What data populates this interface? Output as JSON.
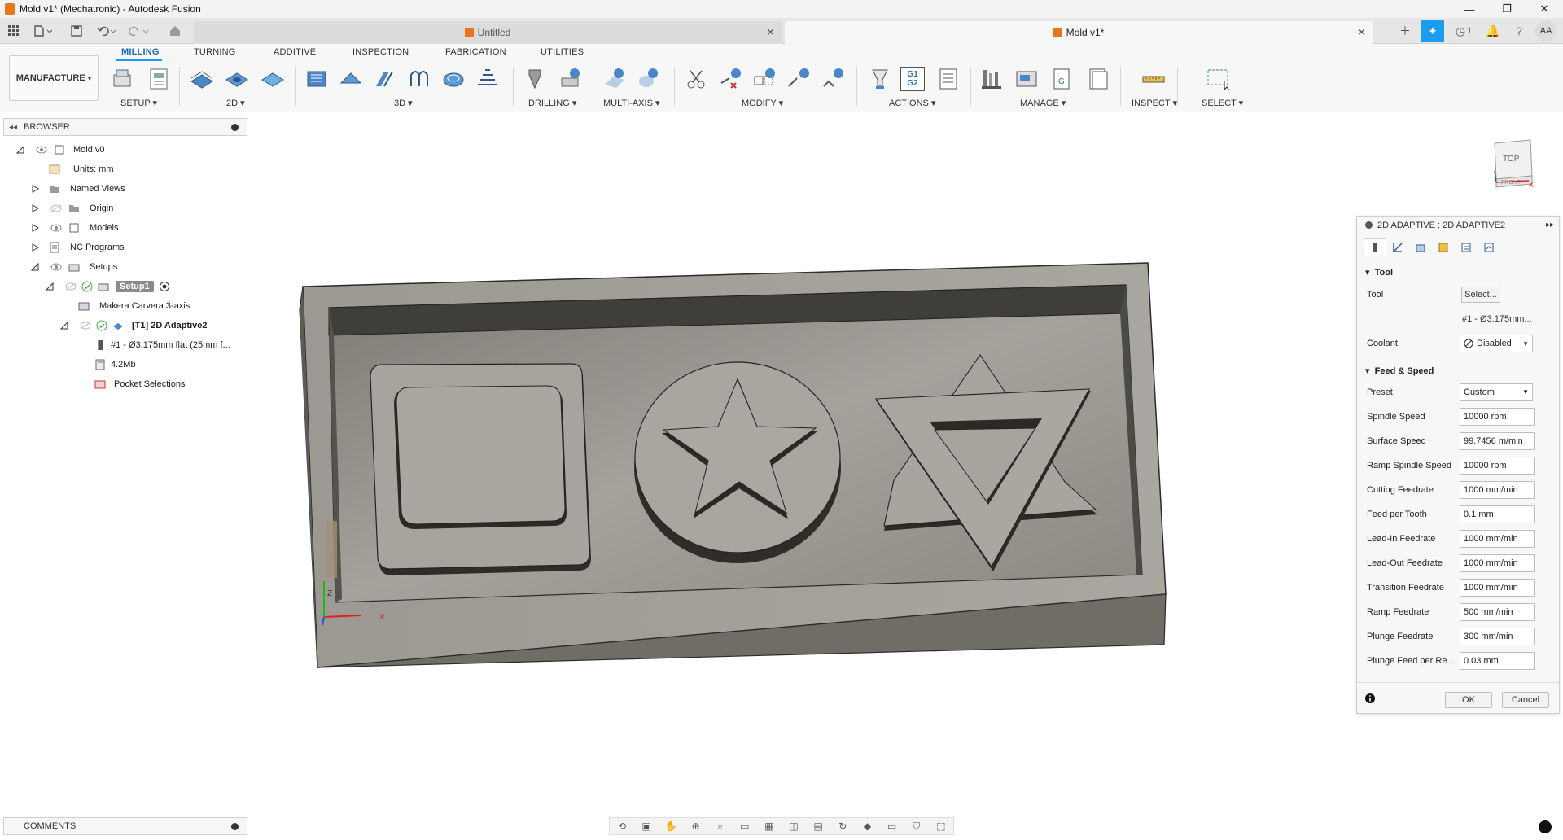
{
  "window": {
    "title": "Mold v1* (Mechatronic) - Autodesk Fusion"
  },
  "window_controls": {
    "minimize": "—",
    "maximize": "❐",
    "close": "✕"
  },
  "tabs": [
    {
      "label": "Untitled",
      "active": false
    },
    {
      "label": "Mold v1*",
      "active": true
    }
  ],
  "header_right": {
    "job_count": "1",
    "user_initials": "AA"
  },
  "ribbon": {
    "workspace": "MANUFACTURE",
    "tabs": [
      "MILLING",
      "TURNING",
      "ADDITIVE",
      "INSPECTION",
      "FABRICATION",
      "UTILITIES"
    ],
    "active_tab": "MILLING",
    "groups": [
      "SETUP",
      "2D",
      "3D",
      "DRILLING",
      "MULTI-AXIS",
      "MODIFY",
      "ACTIONS",
      "MANAGE",
      "INSPECT",
      "SELECT"
    ],
    "group_dropdown": "▾"
  },
  "browser": {
    "title": "BROWSER",
    "items": [
      {
        "label": "Mold v0"
      },
      {
        "label": "Units: mm"
      },
      {
        "label": "Named Views"
      },
      {
        "label": "Origin"
      },
      {
        "label": "Models"
      },
      {
        "label": "NC Programs"
      },
      {
        "label": "Setups"
      },
      {
        "label": "Setup1"
      },
      {
        "label": "Makera Carvera 3-axis"
      },
      {
        "label": "[T1] 2D Adaptive2"
      },
      {
        "label": "#1 - Ø3.175mm flat (25mm f..."
      },
      {
        "label": "4.2Mb"
      },
      {
        "label": "Pocket Selections"
      }
    ]
  },
  "viewcube": {
    "top": "TOP",
    "front": "FRONT",
    "axis_x": "X"
  },
  "viewport_axes": {
    "z": "Z",
    "x": "X"
  },
  "dialog": {
    "title": "2D ADAPTIVE : 2D ADAPTIVE2",
    "sections": {
      "tool": "Tool",
      "feed_speed": "Feed & Speed"
    },
    "tool": {
      "tool_label": "Tool",
      "tool_button": "Select...",
      "tool_name": "#1 - Ø3.175mm...",
      "coolant_label": "Coolant",
      "coolant_value": "Disabled"
    },
    "feed": {
      "preset_label": "Preset",
      "preset_value": "Custom",
      "rows": [
        {
          "label": "Spindle Speed",
          "value": "10000 rpm"
        },
        {
          "label": "Surface Speed",
          "value": "99.7456 m/min"
        },
        {
          "label": "Ramp Spindle Speed",
          "value": "10000 rpm"
        },
        {
          "label": "Cutting Feedrate",
          "value": "1000 mm/min"
        },
        {
          "label": "Feed per Tooth",
          "value": "0.1 mm"
        },
        {
          "label": "Lead-In Feedrate",
          "value": "1000 mm/min"
        },
        {
          "label": "Lead-Out Feedrate",
          "value": "1000 mm/min"
        },
        {
          "label": "Transition Feedrate",
          "value": "1000 mm/min"
        },
        {
          "label": "Ramp Feedrate",
          "value": "500 mm/min"
        },
        {
          "label": "Plunge Feedrate",
          "value": "300 mm/min"
        },
        {
          "label": "Plunge Feed per Re...",
          "value": "0.03 mm"
        }
      ]
    },
    "ok": "OK",
    "cancel": "Cancel"
  },
  "comments": {
    "title": "COMMENTS"
  },
  "colors": {
    "accent": "#1a9cf0",
    "active_tab_text": "#1a6fc4",
    "model_gray": "#8d8b84"
  }
}
